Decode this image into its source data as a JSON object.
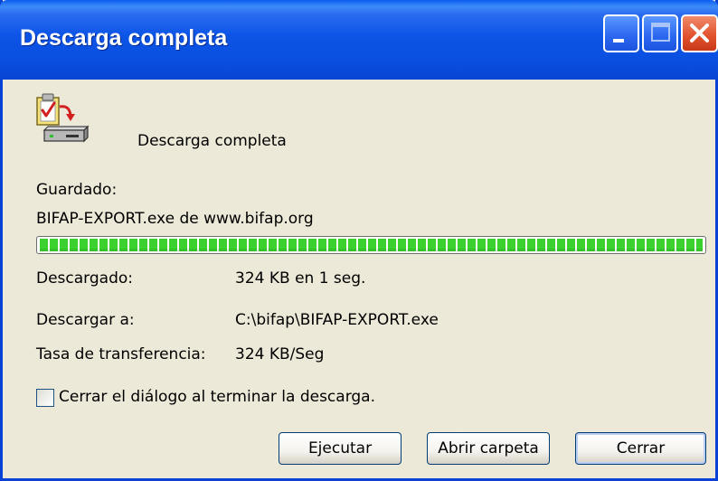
{
  "window": {
    "title": "Descarga completa"
  },
  "titlebar_buttons": {
    "minimize": "minimize-icon",
    "maximize": "maximize-icon",
    "close": "close-icon"
  },
  "header": {
    "icon": "download-complete-icon",
    "message": "Descarga completa"
  },
  "saved": {
    "label": "Guardado:",
    "file_line": "BIFAP-EXPORT.exe de www.bifap.org"
  },
  "progress": {
    "fraction": 1.0,
    "color": "#3bd12e"
  },
  "details": {
    "downloaded_label": "Descargado:",
    "downloaded_value": "324 KB en 1 seg.",
    "download_to_label": "Descargar a:",
    "download_to_value": "C:\\bifap\\BIFAP-EXPORT.exe",
    "rate_label": "Tasa de transferencia:",
    "rate_value": "324 KB/Seg"
  },
  "options": {
    "close_when_done_label": "Cerrar el diálogo al terminar la descarga.",
    "close_when_done_checked": false
  },
  "buttons": {
    "run_label": "Ejecutar",
    "open_folder_label": "Abrir carpeta",
    "close_label": "Cerrar"
  },
  "colors": {
    "titlebar": "#0a4fe0",
    "dialog_bg": "#ece9d8",
    "close_button": "#e0502a"
  }
}
